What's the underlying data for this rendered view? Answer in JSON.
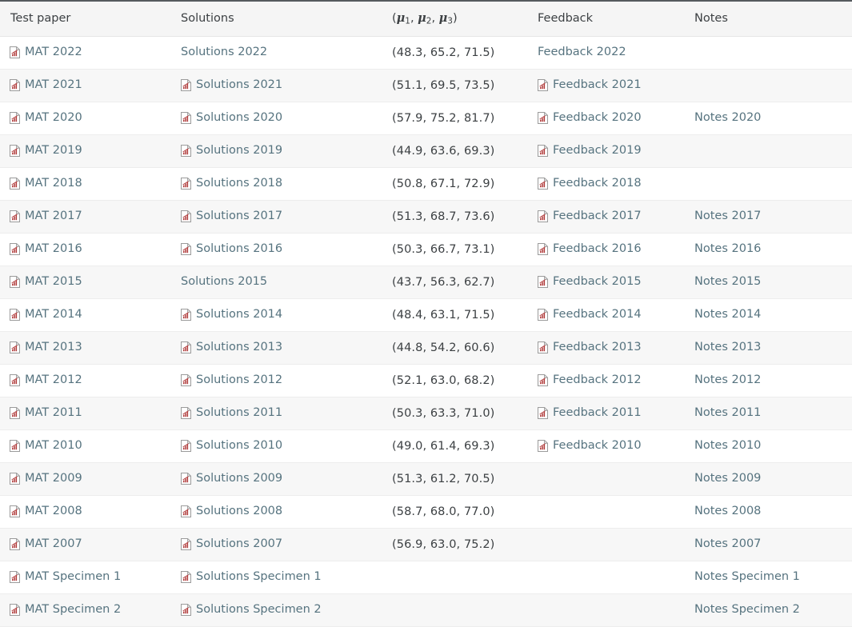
{
  "table": {
    "columns": [
      {
        "key": "test_paper",
        "label": "Test paper"
      },
      {
        "key": "solutions",
        "label": "Solutions"
      },
      {
        "key": "mu",
        "label": "(μ1, μ2, μ3)"
      },
      {
        "key": "feedback",
        "label": "Feedback"
      },
      {
        "key": "notes",
        "label": "Notes"
      }
    ],
    "icon": {
      "name": "pdf-chart-document-icon",
      "page_color": "#ffffff",
      "border_color": "#9b9b9b",
      "chart_color": "#b03a3a"
    },
    "colors": {
      "link": "#56737f",
      "text": "#3c4043",
      "header_bg": "#f5f5f5",
      "row_alt_bg": "#f7f7f7",
      "row_bg": "#ffffff",
      "top_border": "#555a5e",
      "row_border": "#ededed"
    },
    "rows": [
      {
        "test_paper": {
          "text": "MAT 2022",
          "icon": true,
          "link": true
        },
        "solutions": {
          "text": "Solutions 2022",
          "icon": false,
          "link": true
        },
        "mu": {
          "text": "(48.3, 65.2, 71.5)"
        },
        "feedback": {
          "text": "Feedback 2022",
          "icon": false,
          "link": true
        },
        "notes": {
          "text": "",
          "icon": false,
          "link": false
        }
      },
      {
        "test_paper": {
          "text": "MAT 2021",
          "icon": true,
          "link": true
        },
        "solutions": {
          "text": "Solutions 2021",
          "icon": true,
          "link": true
        },
        "mu": {
          "text": "(51.1, 69.5, 73.5)"
        },
        "feedback": {
          "text": "Feedback 2021",
          "icon": true,
          "link": true
        },
        "notes": {
          "text": "",
          "icon": false,
          "link": false
        }
      },
      {
        "test_paper": {
          "text": "MAT 2020",
          "icon": true,
          "link": true
        },
        "solutions": {
          "text": "Solutions 2020",
          "icon": true,
          "link": true
        },
        "mu": {
          "text": "(57.9, 75.2, 81.7)"
        },
        "feedback": {
          "text": "Feedback 2020",
          "icon": true,
          "link": true
        },
        "notes": {
          "text": "Notes 2020",
          "icon": false,
          "link": true
        }
      },
      {
        "test_paper": {
          "text": "MAT 2019",
          "icon": true,
          "link": true
        },
        "solutions": {
          "text": "Solutions 2019",
          "icon": true,
          "link": true
        },
        "mu": {
          "text": "(44.9, 63.6, 69.3)"
        },
        "feedback": {
          "text": "Feedback 2019",
          "icon": true,
          "link": true
        },
        "notes": {
          "text": "",
          "icon": false,
          "link": false
        }
      },
      {
        "test_paper": {
          "text": "MAT 2018",
          "icon": true,
          "link": true
        },
        "solutions": {
          "text": "Solutions 2018",
          "icon": true,
          "link": true
        },
        "mu": {
          "text": "(50.8, 67.1, 72.9)"
        },
        "feedback": {
          "text": "Feedback 2018",
          "icon": true,
          "link": true
        },
        "notes": {
          "text": "",
          "icon": false,
          "link": false
        }
      },
      {
        "test_paper": {
          "text": "MAT 2017",
          "icon": true,
          "link": true
        },
        "solutions": {
          "text": "Solutions 2017",
          "icon": true,
          "link": true
        },
        "mu": {
          "text": "(51.3, 68.7, 73.6)"
        },
        "feedback": {
          "text": "Feedback 2017",
          "icon": true,
          "link": true
        },
        "notes": {
          "text": "Notes 2017",
          "icon": false,
          "link": true
        }
      },
      {
        "test_paper": {
          "text": "MAT 2016",
          "icon": true,
          "link": true
        },
        "solutions": {
          "text": "Solutions 2016",
          "icon": true,
          "link": true
        },
        "mu": {
          "text": "(50.3, 66.7, 73.1)"
        },
        "feedback": {
          "text": "Feedback 2016",
          "icon": true,
          "link": true
        },
        "notes": {
          "text": "Notes 2016",
          "icon": false,
          "link": true
        }
      },
      {
        "test_paper": {
          "text": "MAT 2015",
          "icon": true,
          "link": true
        },
        "solutions": {
          "text": "Solutions 2015",
          "icon": false,
          "link": true
        },
        "mu": {
          "text": "(43.7, 56.3, 62.7)"
        },
        "feedback": {
          "text": "Feedback 2015",
          "icon": true,
          "link": true
        },
        "notes": {
          "text": "Notes 2015",
          "icon": false,
          "link": true
        }
      },
      {
        "test_paper": {
          "text": "MAT 2014",
          "icon": true,
          "link": true
        },
        "solutions": {
          "text": "Solutions 2014",
          "icon": true,
          "link": true
        },
        "mu": {
          "text": "(48.4, 63.1, 71.5)"
        },
        "feedback": {
          "text": "Feedback 2014",
          "icon": true,
          "link": true
        },
        "notes": {
          "text": "Notes 2014",
          "icon": false,
          "link": true
        }
      },
      {
        "test_paper": {
          "text": "MAT 2013",
          "icon": true,
          "link": true
        },
        "solutions": {
          "text": "Solutions 2013",
          "icon": true,
          "link": true
        },
        "mu": {
          "text": "(44.8, 54.2, 60.6)"
        },
        "feedback": {
          "text": "Feedback 2013",
          "icon": true,
          "link": true
        },
        "notes": {
          "text": "Notes 2013",
          "icon": false,
          "link": true
        }
      },
      {
        "test_paper": {
          "text": "MAT 2012",
          "icon": true,
          "link": true
        },
        "solutions": {
          "text": "Solutions 2012",
          "icon": true,
          "link": true
        },
        "mu": {
          "text": "(52.1, 63.0, 68.2)"
        },
        "feedback": {
          "text": "Feedback 2012",
          "icon": true,
          "link": true
        },
        "notes": {
          "text": "Notes 2012",
          "icon": false,
          "link": true
        }
      },
      {
        "test_paper": {
          "text": "MAT 2011",
          "icon": true,
          "link": true
        },
        "solutions": {
          "text": "Solutions 2011",
          "icon": true,
          "link": true
        },
        "mu": {
          "text": "(50.3, 63.3, 71.0)"
        },
        "feedback": {
          "text": "Feedback 2011",
          "icon": true,
          "link": true
        },
        "notes": {
          "text": "Notes 2011",
          "icon": false,
          "link": true
        }
      },
      {
        "test_paper": {
          "text": "MAT 2010",
          "icon": true,
          "link": true
        },
        "solutions": {
          "text": "Solutions 2010",
          "icon": true,
          "link": true
        },
        "mu": {
          "text": "(49.0, 61.4, 69.3)"
        },
        "feedback": {
          "text": "Feedback 2010",
          "icon": true,
          "link": true
        },
        "notes": {
          "text": "Notes 2010",
          "icon": false,
          "link": true
        }
      },
      {
        "test_paper": {
          "text": "MAT 2009",
          "icon": true,
          "link": true
        },
        "solutions": {
          "text": "Solutions 2009",
          "icon": true,
          "link": true
        },
        "mu": {
          "text": "(51.3, 61.2, 70.5)"
        },
        "feedback": {
          "text": "",
          "icon": false,
          "link": false
        },
        "notes": {
          "text": "Notes 2009",
          "icon": false,
          "link": true
        }
      },
      {
        "test_paper": {
          "text": "MAT 2008",
          "icon": true,
          "link": true
        },
        "solutions": {
          "text": "Solutions 2008",
          "icon": true,
          "link": true
        },
        "mu": {
          "text": "(58.7, 68.0, 77.0)"
        },
        "feedback": {
          "text": "",
          "icon": false,
          "link": false
        },
        "notes": {
          "text": "Notes 2008",
          "icon": false,
          "link": true
        }
      },
      {
        "test_paper": {
          "text": "MAT 2007",
          "icon": true,
          "link": true
        },
        "solutions": {
          "text": "Solutions 2007",
          "icon": true,
          "link": true
        },
        "mu": {
          "text": "(56.9, 63.0, 75.2)"
        },
        "feedback": {
          "text": "",
          "icon": false,
          "link": false
        },
        "notes": {
          "text": "Notes 2007",
          "icon": false,
          "link": true
        }
      },
      {
        "test_paper": {
          "text": "MAT Specimen 1",
          "icon": true,
          "link": true
        },
        "solutions": {
          "text": "Solutions Specimen 1",
          "icon": true,
          "link": true
        },
        "mu": {
          "text": ""
        },
        "feedback": {
          "text": "",
          "icon": false,
          "link": false
        },
        "notes": {
          "text": "Notes Specimen 1",
          "icon": false,
          "link": true
        }
      },
      {
        "test_paper": {
          "text": "MAT Specimen 2",
          "icon": true,
          "link": true
        },
        "solutions": {
          "text": "Solutions Specimen 2",
          "icon": true,
          "link": true
        },
        "mu": {
          "text": ""
        },
        "feedback": {
          "text": "",
          "icon": false,
          "link": false
        },
        "notes": {
          "text": "Notes Specimen 2",
          "icon": false,
          "link": true
        }
      }
    ]
  }
}
